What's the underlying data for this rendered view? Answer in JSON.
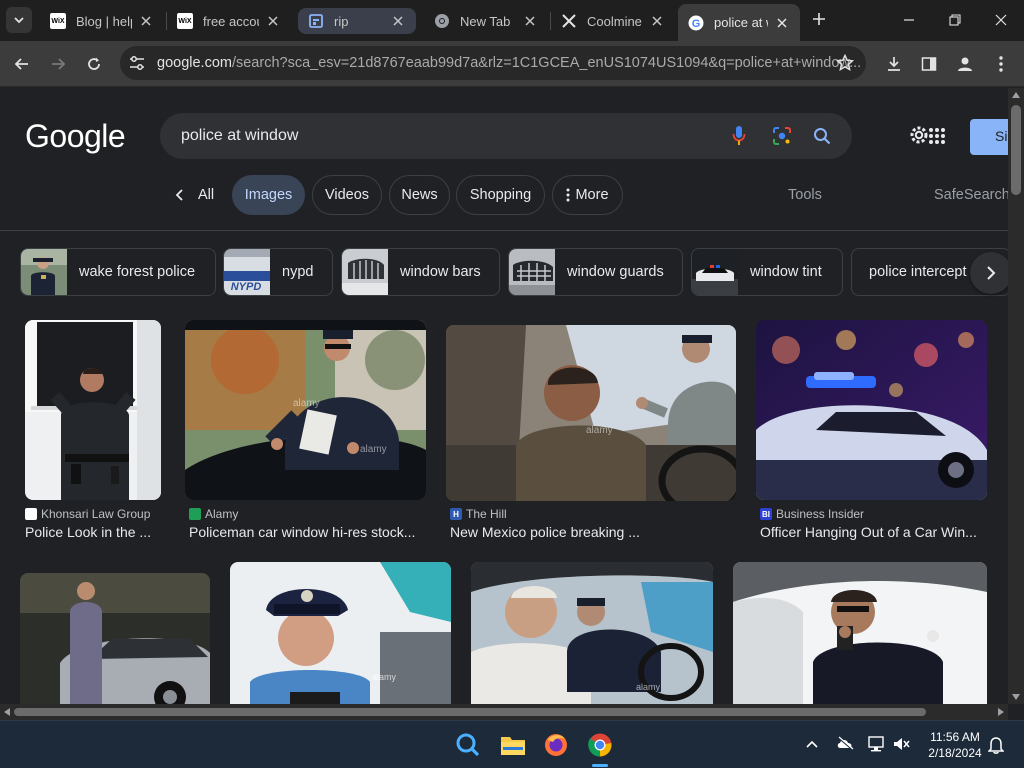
{
  "browser": {
    "tabs": [
      {
        "title": "Blog | help",
        "favicon": "wix-icon"
      },
      {
        "title": "free accou",
        "favicon": "wix-icon"
      },
      {
        "title": "rip",
        "favicon": "site-icon"
      },
      {
        "title": "New Tab",
        "favicon": "chrome-icon"
      },
      {
        "title": "Coolmine",
        "favicon": "x-icon"
      },
      {
        "title": "police at w",
        "favicon": "google-icon"
      }
    ],
    "wix_text": "WiX",
    "url_host": "google.com",
    "url_rest": "/search?sca_esv=21d8767eaab99d7a&rlz=1C1GCEA_enUS1074US1094&q=police+at+window..."
  },
  "google": {
    "logo": "Google",
    "query": "police at window",
    "signin": "Si",
    "nav": {
      "all": "All",
      "images": "Images",
      "videos": "Videos",
      "news": "News",
      "shopping": "Shopping",
      "more": "More",
      "tools": "Tools",
      "safesearch": "SafeSearch"
    },
    "related": [
      "wake forest police",
      "nypd",
      "window bars",
      "window guards",
      "window tint",
      "police intercept"
    ],
    "nypd_thumb_text": "NYPD",
    "results": [
      {
        "source": "Khonsari Law Group",
        "caption": "Police Look in the ..."
      },
      {
        "source": "Alamy",
        "caption": "Policeman car window hi-res stock..."
      },
      {
        "source": "The Hill",
        "caption": "New Mexico police breaking ..."
      },
      {
        "source": "Business Insider",
        "caption": "Officer Hanging Out of a Car Win..."
      },
      {
        "source": "",
        "caption": ""
      },
      {
        "source": "",
        "caption": ""
      },
      {
        "source": "",
        "caption": ""
      },
      {
        "source": "",
        "caption": ""
      }
    ],
    "watermark": "alamy",
    "source_badges": {
      "hill": "H",
      "bi": "BI"
    }
  },
  "taskbar": {
    "time": "11:56 AM",
    "date": "2/18/2024"
  },
  "colors": {
    "accent": "#8ab4f8",
    "chip_selected": "#394457",
    "page_bg": "#202124"
  }
}
